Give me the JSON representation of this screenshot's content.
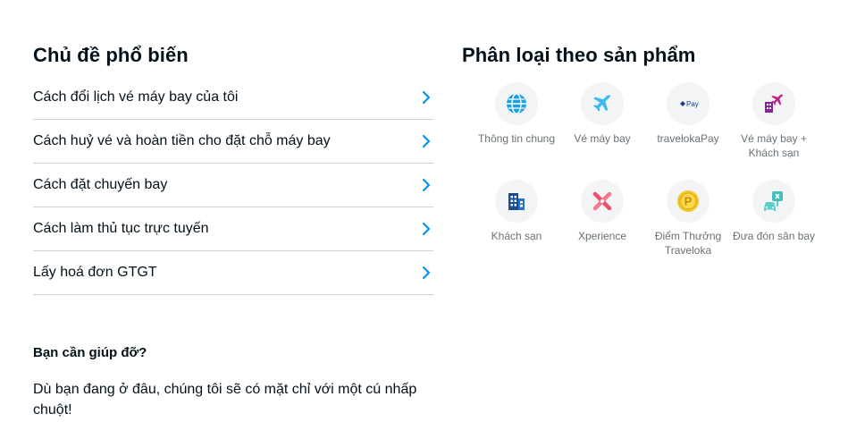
{
  "popular": {
    "title": "Chủ đề phổ biến",
    "topics": [
      "Cách đổi lịch vé máy bay của tôi",
      "Cách huỷ vé và hoàn tiền cho đặt chỗ máy bay",
      "Cách đặt chuyến bay",
      "Cách làm thủ tục trực tuyến",
      "Lấy hoá đơn GTGT"
    ]
  },
  "help": {
    "title": "Bạn cần giúp đỡ?",
    "text": "Dù bạn đang ở đâu, chúng tôi sẽ có mặt chỉ với một cú nhấp chuột!"
  },
  "categories": {
    "title": "Phân loại theo sản phẩm",
    "items": [
      {
        "label": "Thông tin chung",
        "icon": "globe-icon",
        "color": "#1ba0e2"
      },
      {
        "label": "Vé máy bay",
        "icon": "airplane-icon",
        "color": "#35bcf0"
      },
      {
        "label": "travelokaPay",
        "icon": "traveloka-pay-icon",
        "color": "#1b3f8b",
        "icon_text": "Pay"
      },
      {
        "label": "Vé máy bay + Khách sạn",
        "icon": "flight-hotel-icon",
        "color": "#7b2a8f"
      },
      {
        "label": "Khách sạn",
        "icon": "hotel-icon",
        "color": "#1a4e8e"
      },
      {
        "label": "Xperience",
        "icon": "xperience-icon",
        "color": "#f0506e"
      },
      {
        "label": "Điểm Thưởng Traveloka",
        "icon": "points-coin-icon",
        "color": "#f6c624",
        "icon_text": "P"
      },
      {
        "label": "Đưa đón sân bay",
        "icon": "airport-transfer-icon",
        "color": "#3fbfb8"
      }
    ]
  },
  "colors": {
    "chevron": "#0194f3",
    "text": "#03121a",
    "muted": "#687176",
    "divider": "#cdd0d1"
  }
}
